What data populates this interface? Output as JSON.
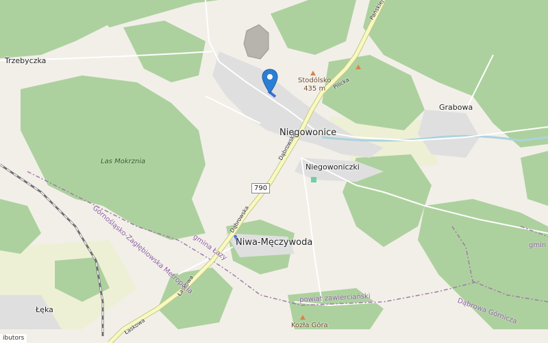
{
  "places": {
    "trzebyczka": "Trzebyczka",
    "niegowonice": "Niegowonice",
    "niegowoniczki": "Niegowoniczki",
    "grabowa": "Grabowa",
    "niwa": "Niwa-Męczywoda",
    "leka": "Łęka"
  },
  "peaks": {
    "stodolsko_name": "Stodólsko",
    "stodolsko_ele": "435 m",
    "kozla_gora": "Kozła Góra"
  },
  "forests": {
    "las_mokrznia": "Las Mokrznia"
  },
  "admin": {
    "metropolia": "Górnośląsko-Zagłębiowska Metropolia",
    "gmina_lazy": "gmina Łazy",
    "powiat": "powiat zawierciański",
    "dabrowa": "Dąbrowa Górnicza",
    "gmina_edge": "gmin"
  },
  "roads": {
    "route_790": "790",
    "dabrowska_upper": "Dąbrowska",
    "dabrowska_lower": "Dąbrowska",
    "pilicka": "Pilicka",
    "panska": "Pańskiej",
    "laskowa": "Łaskowa"
  },
  "marker": {
    "icon": "map-pin-icon",
    "color": "#2a7fd4"
  },
  "attribution": "ibutors"
}
